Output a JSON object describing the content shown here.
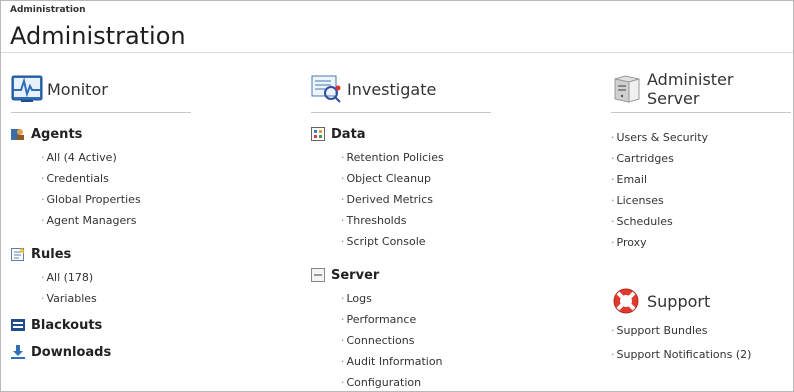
{
  "breadcrumb": "Administration",
  "page_title": "Administration",
  "monitor": {
    "title": "Monitor",
    "agents": {
      "label": "Agents",
      "items": [
        "All (4 Active)",
        "Credentials",
        "Global Properties",
        "Agent Managers"
      ]
    },
    "rules": {
      "label": "Rules",
      "items": [
        "All  (178)",
        "Variables"
      ]
    },
    "blackouts": "Blackouts",
    "downloads": "Downloads"
  },
  "investigate": {
    "title": "Investigate",
    "data": {
      "label": "Data",
      "items": [
        "Retention Policies",
        "Object Cleanup",
        "Derived Metrics",
        "Thresholds",
        "Script Console"
      ]
    },
    "server": {
      "label": "Server",
      "items": [
        "Logs",
        "Performance",
        "Connections",
        "Audit Information",
        "Configuration"
      ]
    }
  },
  "administer": {
    "title": "Administer Server",
    "items": [
      "Users & Security",
      "Cartridges",
      "Email",
      "Licenses",
      "Schedules",
      "Proxy"
    ]
  },
  "support": {
    "title": "Support",
    "items": [
      "Support Bundles",
      "Support Notifications (2)"
    ]
  }
}
